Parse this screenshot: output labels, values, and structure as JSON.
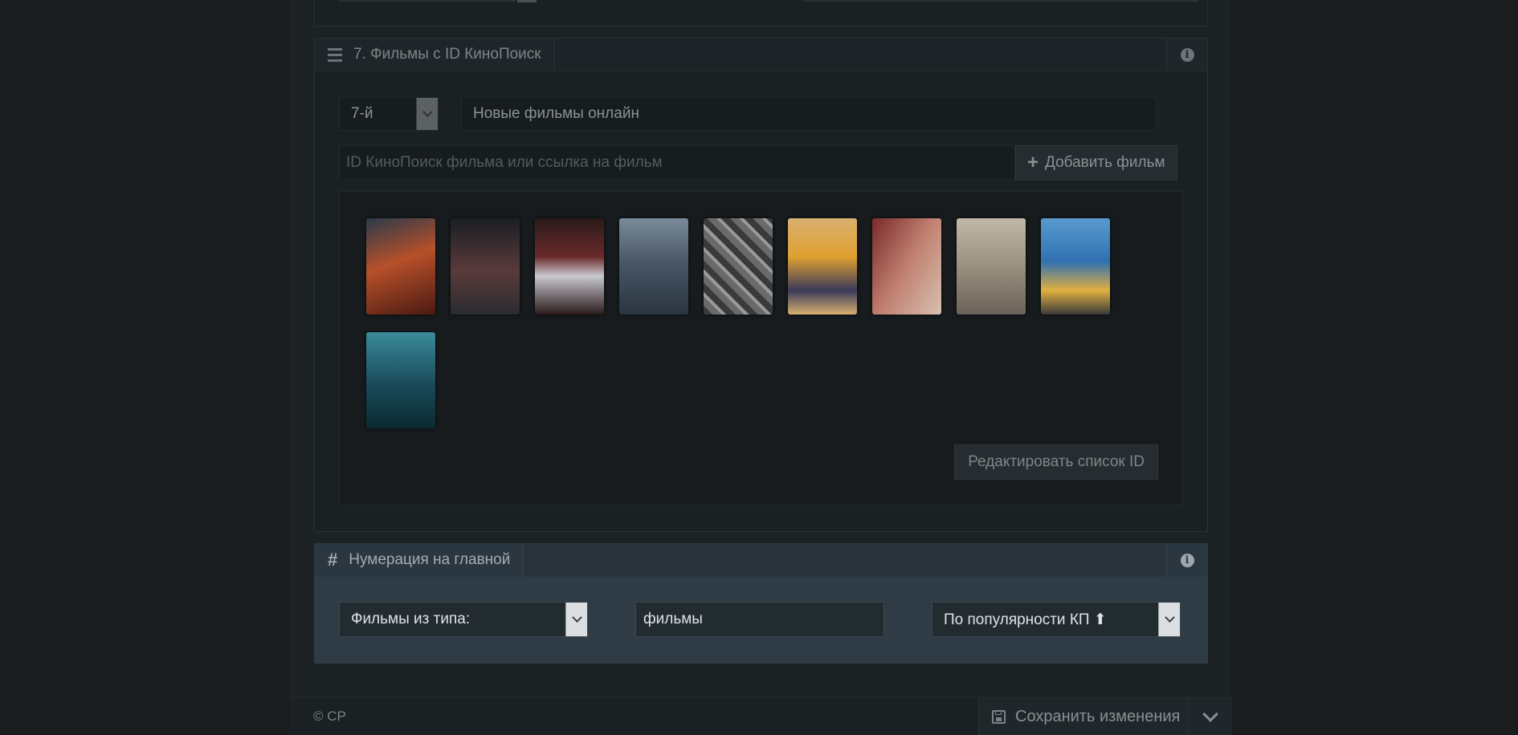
{
  "section7": {
    "title": "7. Фильмы с ID КиноПоиск",
    "position_select": "7-й",
    "heading_value": "Новые фильмы онлайн",
    "id_input_placeholder": "ID КиноПоиск фильма или ссылка на фильм",
    "add_button": "Добавить фильм",
    "edit_button": "Редактировать список ID",
    "posters": [
      {
        "name": "poster-1",
        "colors": [
          "#4a1a12",
          "#b7502a",
          "#2a3a4a"
        ]
      },
      {
        "name": "poster-2",
        "colors": [
          "#1a1e24",
          "#5a3a3a",
          "#8a8a8a"
        ]
      },
      {
        "name": "poster-3",
        "colors": [
          "#2a1a1a",
          "#6a2a2a",
          "#c8c8d0"
        ]
      },
      {
        "name": "poster-4",
        "colors": [
          "#2a3440",
          "#4a5866",
          "#7a8a9a"
        ]
      },
      {
        "name": "poster-5",
        "colors": [
          "#3a3a3a",
          "#6a6a6a",
          "#9a9a9a"
        ]
      },
      {
        "name": "poster-6",
        "colors": [
          "#d8b070",
          "#e0a030",
          "#3a3a5a"
        ]
      },
      {
        "name": "poster-7",
        "colors": [
          "#7a2a2a",
          "#c08070",
          "#d8c0b0"
        ]
      },
      {
        "name": "poster-8",
        "colors": [
          "#6a6258",
          "#9a9080",
          "#c0b8a8"
        ]
      },
      {
        "name": "poster-9",
        "colors": [
          "#3070b0",
          "#e0b040",
          "#5a9ad0"
        ]
      },
      {
        "name": "poster-10",
        "colors": [
          "#1a4a5a",
          "#3a8a9a",
          "#0a2a30"
        ]
      }
    ]
  },
  "numbering": {
    "title": "Нумерация на главной",
    "type_select": "Фильмы из типа:",
    "type_value": "фильмы",
    "sort_select": "По популярности КП ⬆"
  },
  "footer": {
    "copyright": "© CP",
    "save_button": "Сохранить изменения"
  }
}
